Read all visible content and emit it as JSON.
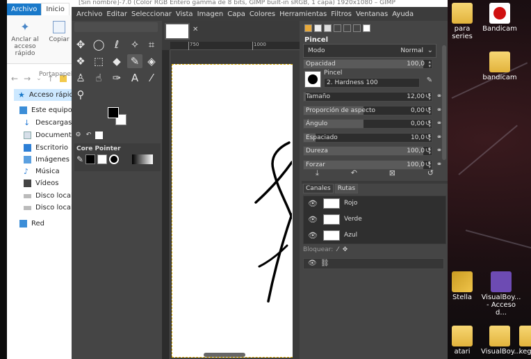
{
  "gimp": {
    "title": "[Sin nombre]-7.0 (Color RGB Entero gamma de 8 bits, GIMP built-in sRGB, 1 capa) 1920x1080 – GIMP",
    "menu": [
      "Archivo",
      "Editar",
      "Seleccionar",
      "Vista",
      "Imagen",
      "Capa",
      "Colores",
      "Herramientas",
      "Filtros",
      "Ventanas",
      "Ayuda"
    ],
    "toolbox": {
      "tools": [
        {
          "name": "move-tool",
          "glyph": "✥"
        },
        {
          "name": "ellipse-select-tool",
          "glyph": "◯"
        },
        {
          "name": "lasso-tool",
          "glyph": "ℓ"
        },
        {
          "name": "fuzzy-select-tool",
          "glyph": "✧"
        },
        {
          "name": "crop-tool",
          "glyph": "⌗"
        },
        {
          "name": "warp-transform-tool",
          "glyph": "❖"
        },
        {
          "name": "unified-transform-tool",
          "glyph": "⬚"
        },
        {
          "name": "bucket-fill-tool",
          "glyph": "◆"
        },
        {
          "name": "paintbrush-tool",
          "glyph": "✎"
        },
        {
          "name": "eraser-tool",
          "glyph": "◈"
        },
        {
          "name": "clone-tool",
          "glyph": "♙"
        },
        {
          "name": "smudge-tool",
          "glyph": "☝"
        },
        {
          "name": "paths-tool",
          "glyph": "✑"
        },
        {
          "name": "text-tool",
          "glyph": "A"
        },
        {
          "name": "color-picker-tool",
          "glyph": "⁄"
        },
        {
          "name": "zoom-tool",
          "glyph": "⚲"
        }
      ],
      "device_status_label": "Core Pointer"
    },
    "canvas": {
      "ruler_labels": [
        "750",
        "1000"
      ]
    },
    "tool_options": {
      "panel_title": "Pincel",
      "mode_label": "Modo",
      "mode_value": "Normal",
      "opacity_label": "Opacidad",
      "opacity_value": "100,0",
      "opacity_fraction": 1.0,
      "brush_label": "Pincel",
      "brush_name": "2. Hardness 100",
      "sliders": [
        {
          "label": "Tamaño",
          "value": "12,00",
          "fraction": 0.02
        },
        {
          "label": "Proporción de aspecto",
          "value": "0,00",
          "fraction": 0.5
        },
        {
          "label": "Ángulo",
          "value": "0,00",
          "fraction": 0.5
        },
        {
          "label": "Espaciado",
          "value": "10,0",
          "fraction": 0.1
        },
        {
          "label": "Dureza",
          "value": "100,0",
          "fraction": 1.0
        },
        {
          "label": "Forzar",
          "value": "100,0",
          "fraction": 1.0
        }
      ]
    },
    "channels": {
      "tabs": [
        "Canales",
        "Rutas"
      ],
      "items": [
        "Rojo",
        "Verde",
        "Azul"
      ],
      "lock_label": "Bloquear:"
    }
  },
  "explorer": {
    "tabs": [
      "Archivo",
      "Inicio"
    ],
    "ribbon": {
      "pin_label": "Anclar al acceso rápido",
      "copy_label": "Copiar",
      "group_label": "Portapapeles"
    },
    "nav": [
      "Acceso rápido",
      "Este equipo",
      "Descargas",
      "Documentos",
      "Escritorio",
      "Imágenes",
      "Música",
      "Vídeos",
      "Disco local (C:",
      "Disco local (E:)",
      "Red"
    ]
  },
  "desktop": {
    "icons": [
      "para series",
      "Bandicam",
      "bandicam",
      "Stella",
      "VisualBoy... - Acceso d...",
      "atari",
      "VisualBoy...",
      "kegi"
    ]
  },
  "colors": {
    "gimp_bg": "#454545",
    "canvas_bg": "#3b3b3b",
    "explorer_accent": "#1979ca",
    "selection_dash": "#e6b400"
  }
}
